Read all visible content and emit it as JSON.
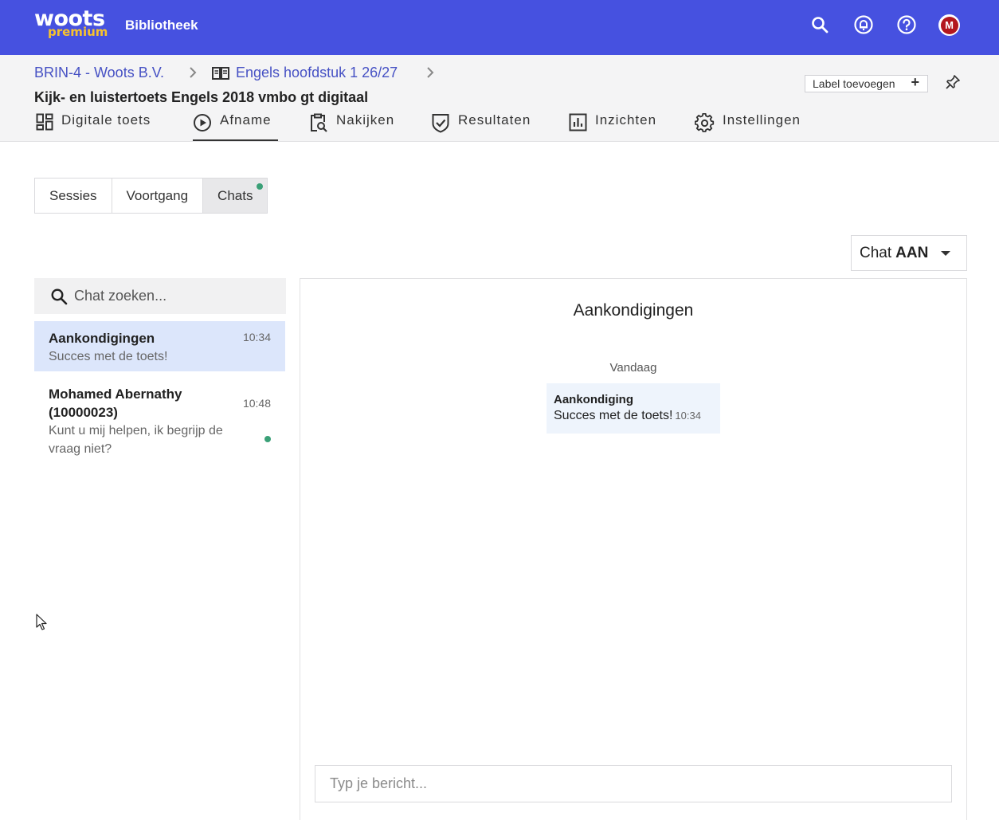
{
  "topbar": {
    "logo_main": "woots",
    "logo_sub": "premium",
    "library_label": "Bibliotheek",
    "avatar_initial": "M",
    "icons": [
      "search-icon",
      "notification-icon",
      "help-icon"
    ]
  },
  "breadcrumb": {
    "org": "BRIN-4 - Woots B.V.",
    "course": "Engels hoofdstuk 1 26/27"
  },
  "page_title": "Kijk- en luistertoets Engels 2018 vmbo gt digitaal",
  "label_button": "Label toevoegen",
  "main_tabs": [
    {
      "label": "Digitale toets",
      "icon": "dashboard-icon"
    },
    {
      "label": "Afname",
      "icon": "play-circle-icon",
      "active": true
    },
    {
      "label": "Nakijken",
      "icon": "clipboard-search-icon"
    },
    {
      "label": "Resultaten",
      "icon": "shield-check-icon"
    },
    {
      "label": "Inzichten",
      "icon": "bar-chart-icon"
    },
    {
      "label": "Instellingen",
      "icon": "gear-icon"
    }
  ],
  "sub_tabs": [
    {
      "label": "Sessies"
    },
    {
      "label": "Voortgang"
    },
    {
      "label": "Chats",
      "active": true
    }
  ],
  "chat_toggle": {
    "prefix": "Chat",
    "state": "AAN"
  },
  "search": {
    "placeholder": "Chat zoeken..."
  },
  "conversations": [
    {
      "name": "Aankondigingen",
      "message": "Succes met de toets!",
      "time": "10:34",
      "active": true
    },
    {
      "name": "Mohamed Abernathy (10000023)",
      "message": "Kunt u mij helpen, ik begrijp de vraag niet?",
      "time": "10:48",
      "unread": true
    }
  ],
  "chat_panel": {
    "title": "Aankondigingen",
    "day_label": "Vandaag",
    "messages": [
      {
        "sender": "Aankondiging",
        "text": "Succes met de toets!",
        "time": "10:34"
      }
    ],
    "input_placeholder": "Typ je bericht..."
  },
  "colors": {
    "topbar": "#4651e0",
    "accent_link": "#4651c4",
    "active_conversation": "#dce6fb",
    "unread_dot": "#3aa077",
    "avatar": "#b3171d",
    "logo_sub": "#f7c32e"
  }
}
